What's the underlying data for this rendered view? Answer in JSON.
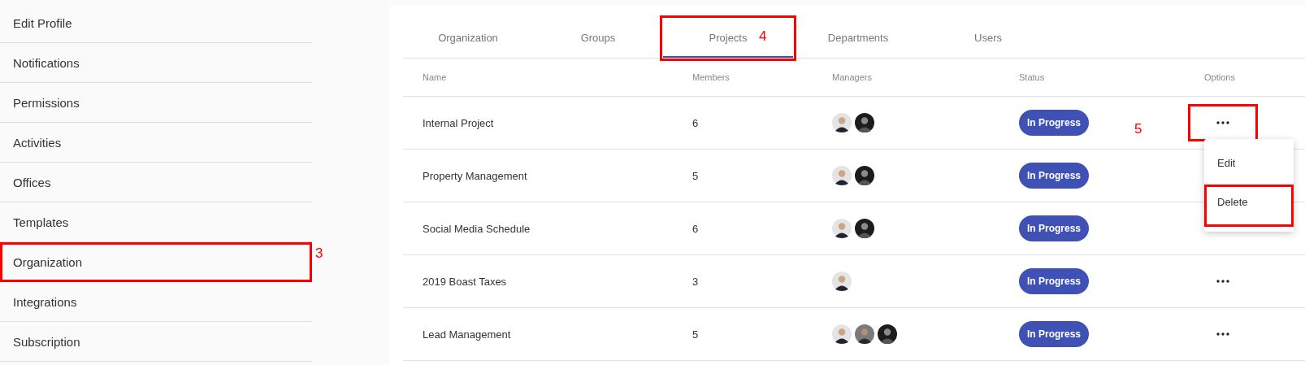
{
  "sidebar": {
    "items": [
      {
        "label": "Edit Profile",
        "highlighted": false
      },
      {
        "label": "Notifications",
        "highlighted": false
      },
      {
        "label": "Permissions",
        "highlighted": false
      },
      {
        "label": "Activities",
        "highlighted": false
      },
      {
        "label": "Offices",
        "highlighted": false
      },
      {
        "label": "Templates",
        "highlighted": false
      },
      {
        "label": "Organization",
        "highlighted": true,
        "callout": "3"
      },
      {
        "label": "Integrations",
        "highlighted": false
      },
      {
        "label": "Subscription",
        "highlighted": false
      }
    ]
  },
  "tabs": [
    {
      "label": "Organization",
      "selected": false,
      "highlighted": false
    },
    {
      "label": "Groups",
      "selected": false,
      "highlighted": false
    },
    {
      "label": "Projects",
      "selected": true,
      "highlighted": true,
      "callout": "4"
    },
    {
      "label": "Departments",
      "selected": false,
      "highlighted": false
    },
    {
      "label": "Users",
      "selected": false,
      "highlighted": false
    }
  ],
  "table": {
    "columns": [
      "Name",
      "Members",
      "Managers",
      "Status",
      "Options"
    ],
    "rows": [
      {
        "name": "Internal Project",
        "members": "6",
        "managers": [
          {
            "kind": "person"
          },
          {
            "kind": "dark"
          }
        ],
        "status": "In Progress",
        "options": {
          "highlighted": true
        },
        "callout": "5",
        "menu": {
          "items": [
            {
              "label": "Edit",
              "highlighted": false
            },
            {
              "label": "Delete",
              "highlighted": true
            }
          ]
        }
      },
      {
        "name": "Property Management",
        "members": "5",
        "managers": [
          {
            "kind": "person"
          },
          {
            "kind": "dark"
          }
        ],
        "status": "In Progress"
      },
      {
        "name": "Social Media Schedule",
        "members": "6",
        "managers": [
          {
            "kind": "person"
          },
          {
            "kind": "dark"
          }
        ],
        "status": "In Progress"
      },
      {
        "name": "2019 Boast Taxes",
        "members": "3",
        "managers": [
          {
            "kind": "person"
          }
        ],
        "status": "In Progress",
        "options": {
          "highlighted": false
        }
      },
      {
        "name": "Lead Management",
        "members": "5",
        "managers": [
          {
            "kind": "person"
          },
          {
            "kind": "grey"
          },
          {
            "kind": "dark"
          }
        ],
        "status": "In Progress",
        "options": {
          "highlighted": false
        }
      }
    ]
  }
}
